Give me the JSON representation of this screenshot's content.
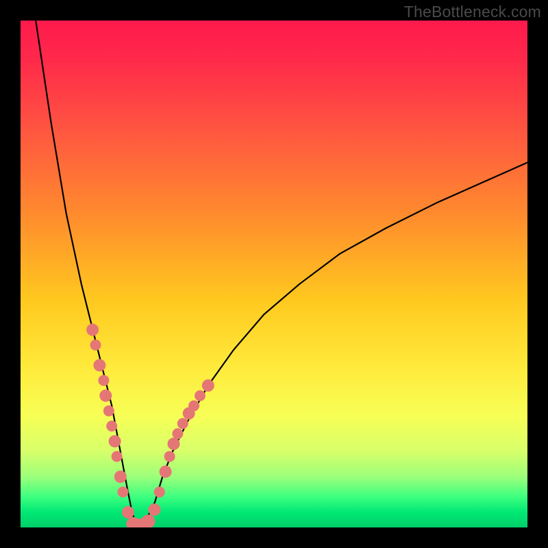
{
  "watermark": "TheBottleneck.com",
  "chart_data": {
    "type": "line",
    "title": "",
    "xlabel": "",
    "ylabel": "",
    "xlim": [
      0,
      100
    ],
    "ylim": [
      0,
      100
    ],
    "grid": false,
    "legend": false,
    "description": "V-shaped bottleneck curve over red-to-green vertical gradient. Minimum at ~x=23 where y≈0. Left branch rises steeply to y≈100 at x≈3. Right branch rises shallowly to y≈72 at x=100.",
    "series": [
      {
        "name": "bottleneck-curve",
        "x": [
          3,
          6,
          9,
          12,
          14,
          16,
          18,
          19.5,
          21,
          22,
          23,
          24,
          25,
          26.5,
          28,
          30,
          33,
          37,
          42,
          48,
          55,
          63,
          72,
          82,
          91,
          100
        ],
        "y": [
          100,
          80,
          62,
          48,
          40,
          32,
          24,
          16,
          8,
          3,
          0,
          0,
          2,
          5,
          10,
          15,
          21,
          28,
          35,
          42,
          48,
          54,
          59,
          64,
          68,
          72
        ]
      }
    ],
    "markers": [
      {
        "x": 14.2,
        "y": 39,
        "r": 9
      },
      {
        "x": 14.8,
        "y": 36,
        "r": 8
      },
      {
        "x": 15.6,
        "y": 32,
        "r": 9
      },
      {
        "x": 16.4,
        "y": 29,
        "r": 8
      },
      {
        "x": 16.8,
        "y": 26,
        "r": 9
      },
      {
        "x": 17.4,
        "y": 23,
        "r": 8
      },
      {
        "x": 18.0,
        "y": 20,
        "r": 8
      },
      {
        "x": 18.6,
        "y": 17,
        "r": 9
      },
      {
        "x": 19.0,
        "y": 14,
        "r": 8
      },
      {
        "x": 19.7,
        "y": 10,
        "r": 9
      },
      {
        "x": 20.2,
        "y": 7,
        "r": 8
      },
      {
        "x": 21.2,
        "y": 3,
        "r": 9
      },
      {
        "x": 22.2,
        "y": 0.7,
        "r": 10
      },
      {
        "x": 23.2,
        "y": 0.4,
        "r": 10
      },
      {
        "x": 24.2,
        "y": 0.5,
        "r": 10
      },
      {
        "x": 25.2,
        "y": 1.2,
        "r": 10
      },
      {
        "x": 26.4,
        "y": 3.5,
        "r": 9
      },
      {
        "x": 27.4,
        "y": 7,
        "r": 8
      },
      {
        "x": 28.6,
        "y": 11,
        "r": 9
      },
      {
        "x": 29.4,
        "y": 14,
        "r": 8
      },
      {
        "x": 30.2,
        "y": 16.5,
        "r": 9
      },
      {
        "x": 31.0,
        "y": 18.5,
        "r": 8
      },
      {
        "x": 32.0,
        "y": 20.5,
        "r": 8
      },
      {
        "x": 33.2,
        "y": 22.5,
        "r": 9
      },
      {
        "x": 34.2,
        "y": 24,
        "r": 8
      },
      {
        "x": 35.4,
        "y": 26,
        "r": 8
      },
      {
        "x": 37.0,
        "y": 28,
        "r": 9
      }
    ]
  }
}
